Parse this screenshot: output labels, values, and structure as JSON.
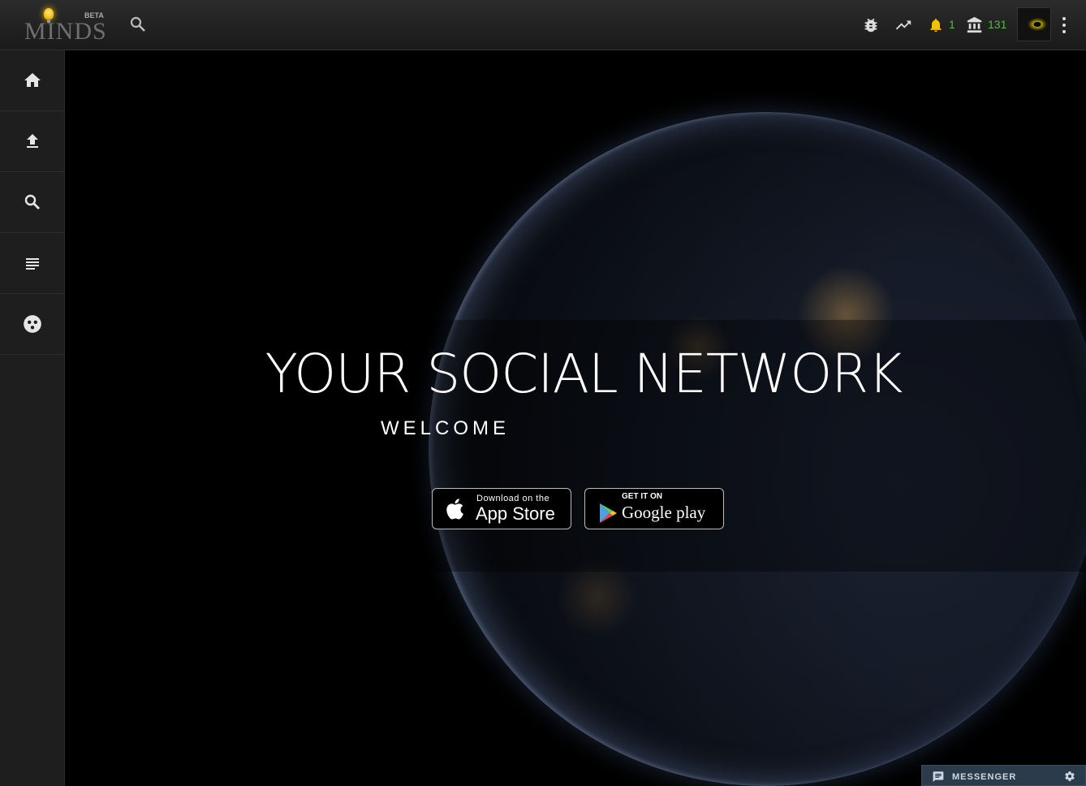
{
  "topbar": {
    "logo_text": "MINDS",
    "logo_badge": "BETA",
    "icons": {
      "search": "search-icon",
      "bug": "bug-icon",
      "trending": "trending-icon",
      "notifications": "bell-icon",
      "wallet": "bank-icon",
      "menu": "more-vert-icon"
    },
    "notifications_count": "1",
    "points_count": "131",
    "accent_bell": "#f2c000",
    "accent_count": "#55b849"
  },
  "sidebar": {
    "items": [
      {
        "name": "home",
        "icon": "home-icon"
      },
      {
        "name": "upload",
        "icon": "upload-icon"
      },
      {
        "name": "search",
        "icon": "search-icon"
      },
      {
        "name": "newsfeed",
        "icon": "list-icon"
      },
      {
        "name": "groups",
        "icon": "groups-icon"
      }
    ]
  },
  "hero": {
    "title": "YOUR SOCIAL NETWORK",
    "subtitle": "WELCOME",
    "appstore": {
      "small": "Download on the",
      "big": "App Store"
    },
    "googleplay": {
      "small": "GET IT ON",
      "big": "Google play"
    }
  },
  "messenger": {
    "label": "MESSENGER"
  }
}
